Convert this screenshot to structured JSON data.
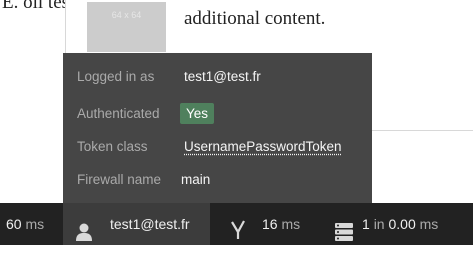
{
  "background": {
    "fragment_text": "E. oii tests.",
    "image_placeholder_label": "64 x 64",
    "content_text": "additional content."
  },
  "security_panel": {
    "rows": [
      {
        "label": "Logged in as",
        "value": "test1@test.fr"
      },
      {
        "label": "Authenticated",
        "value": "Yes"
      },
      {
        "label": "Token class",
        "value": "UsernamePasswordToken"
      },
      {
        "label": "Firewall name",
        "value": "main"
      }
    ],
    "colors": {
      "panel_bg": "#464646",
      "badge_bg": "#4f805d"
    }
  },
  "toolbar": {
    "time": {
      "value": "60",
      "unit": "ms"
    },
    "user": {
      "icon": "person-icon",
      "label": "test1@test.fr"
    },
    "performance": {
      "icon": "tuning-fork-icon",
      "value": "16",
      "unit": "ms"
    },
    "database": {
      "icon": "database-icon",
      "count": "1",
      "in": "in",
      "time": "0.00",
      "unit": "ms"
    },
    "colors": {
      "bar_bg": "#222222",
      "active_item_bg": "#3c3c3c"
    }
  }
}
